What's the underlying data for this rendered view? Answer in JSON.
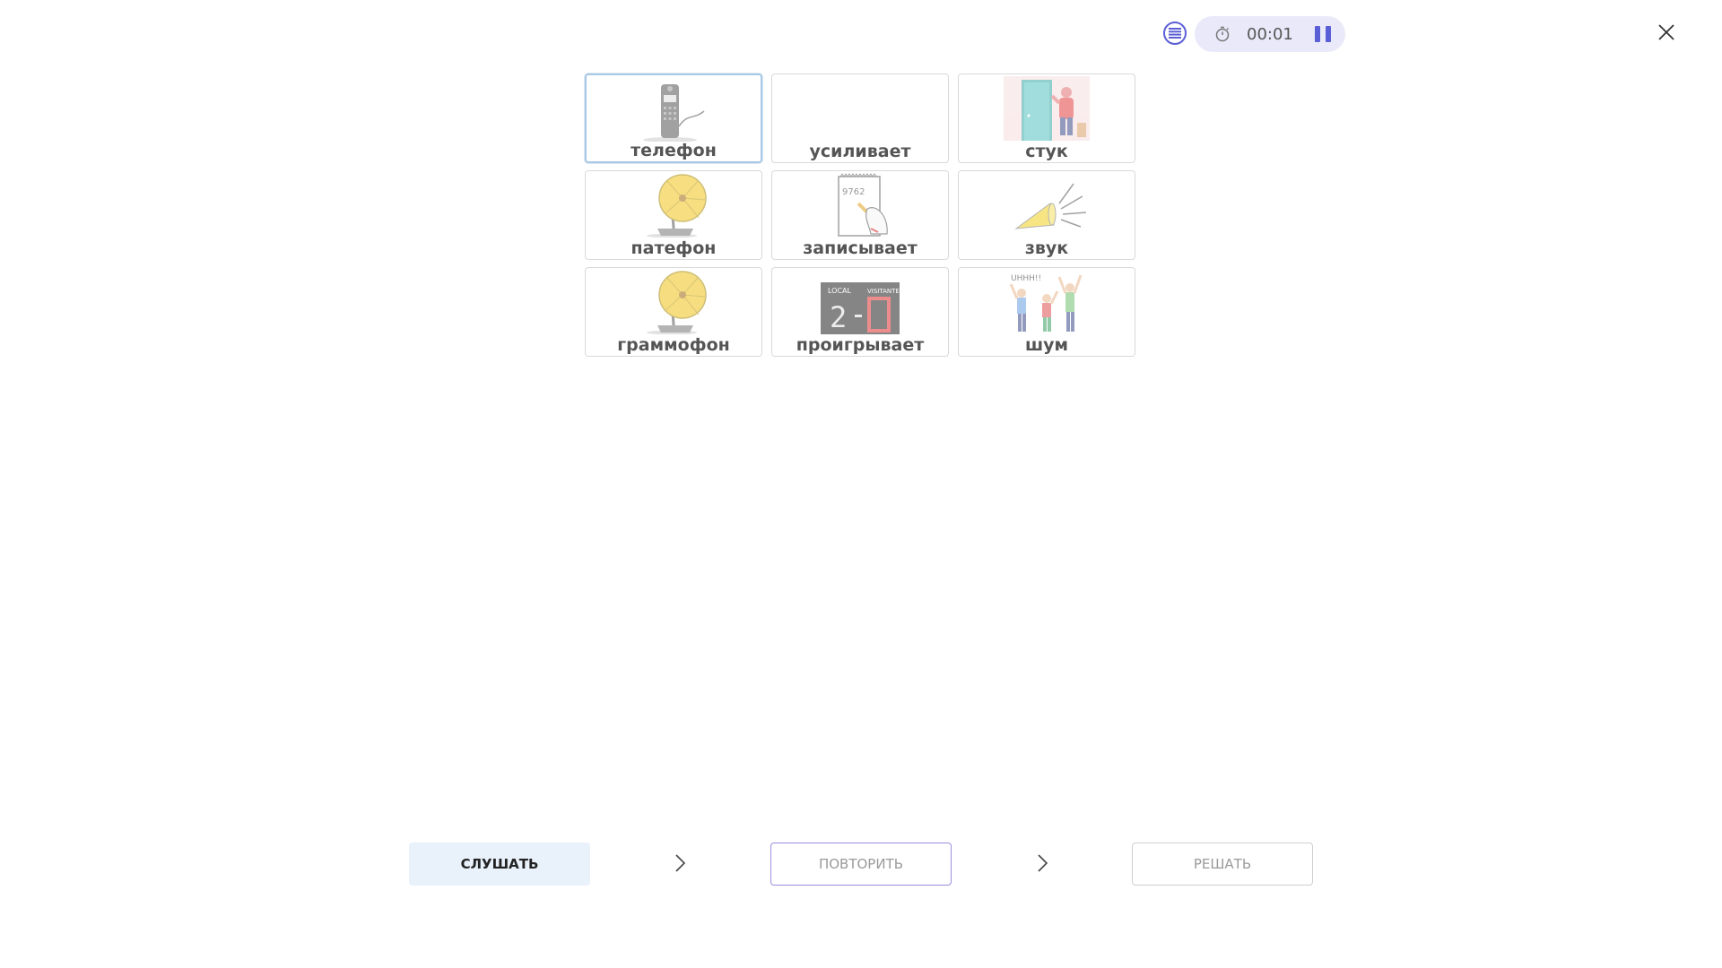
{
  "toolbar": {
    "menu_icon": "list-icon",
    "clock_icon": "stopwatch-icon",
    "time": "00:01",
    "pause_icon": "pause-icon",
    "close_icon": "close-icon",
    "accent_color": "#5b5fd6"
  },
  "cards": [
    {
      "label": "телефон",
      "icon": "telephone-picture",
      "selected": true
    },
    {
      "label": "усиливает",
      "icon": "",
      "selected": false
    },
    {
      "label": "стук",
      "icon": "knocking-door-picture",
      "selected": false
    },
    {
      "label": "патефон",
      "icon": "gramophone-picture",
      "selected": false
    },
    {
      "label": "записывает",
      "icon": "writing-notepad-picture",
      "selected": false
    },
    {
      "label": "звук",
      "icon": "megaphone-sound-picture",
      "selected": false
    },
    {
      "label": "граммофон",
      "icon": "gramophone-picture",
      "selected": false
    },
    {
      "label": "проигрывает",
      "icon": "scoreboard-picture",
      "selected": false
    },
    {
      "label": "шум",
      "icon": "cheering-people-picture",
      "selected": false
    }
  ],
  "controls": {
    "listen_label": "СЛУШАТЬ",
    "repeat_label": "ПОВТОРИТЬ",
    "solve_label": "РЕШАТЬ",
    "step_icon": "chevron-right-icon"
  }
}
